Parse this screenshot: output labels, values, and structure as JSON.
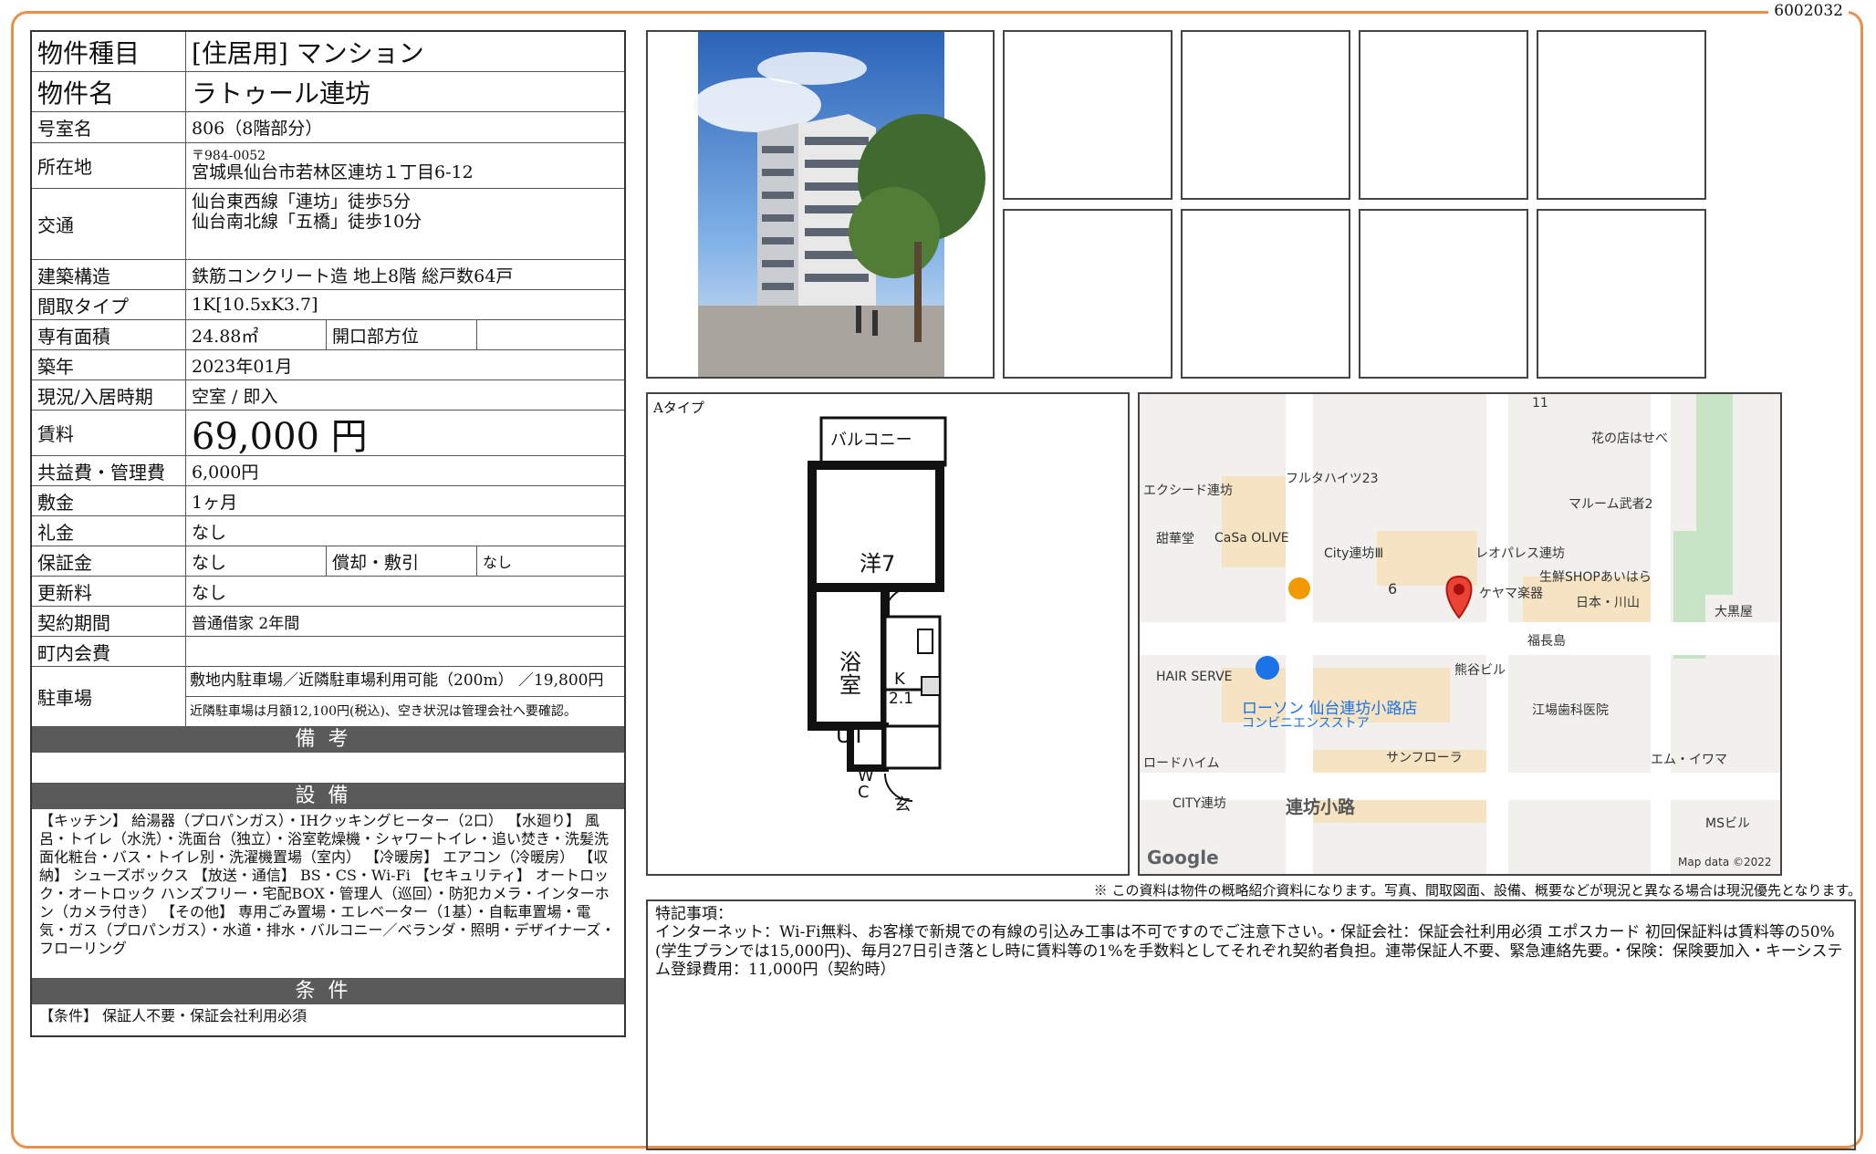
{
  "doc_id": "6002032",
  "property": {
    "type_label": "物件種目",
    "type_value": "[住居用] マンション",
    "name_label": "物件名",
    "name_value": "ラトゥール連坊",
    "room_label": "号室名",
    "room_value": "806（8階部分）",
    "address_label": "所在地",
    "postal": "〒984-0052",
    "address": "宮城県仙台市若林区連坊１丁目6-12",
    "transit_label": "交通",
    "transit_1": "仙台東西線「連坊」徒歩5分",
    "transit_2": "仙台南北線「五橋」徒歩10分",
    "structure_label": "建築構造",
    "structure_value": "鉄筋コンクリート造 地上8階 総戸数64戸",
    "layout_label": "間取タイプ",
    "layout_value": "1K[10.5xK3.7]",
    "area_label": "専有面積",
    "area_value": "24.88㎡",
    "facing_label": "開口部方位",
    "facing_value": "",
    "built_label": "築年",
    "built_value": "2023年01月",
    "status_label": "現況/入居時期",
    "status_value": "空室 / 即入",
    "rent_label": "賃料",
    "rent_value": "69,000 円",
    "fee_label": "共益費・管理費",
    "fee_value": "6,000円",
    "deposit_label": "敷金",
    "deposit_value": "1ヶ月",
    "keymoney_label": "礼金",
    "keymoney_value": "なし",
    "guarantee_label": "保証金",
    "guarantee_value": "なし",
    "amort_label": "償却・敷引",
    "amort_value": "なし",
    "renewal_label": "更新料",
    "renewal_value": "なし",
    "contract_label": "契約期間",
    "contract_value": "普通借家 2年間",
    "community_label": "町内会費",
    "community_value": "",
    "parking_label": "駐車場",
    "parking_value": "敷地内駐車場／近隣駐車場利用可能（200m） ／19,800円",
    "parking_note": "近隣駐車場は月額12,100円(税込)、空き状況は管理会社へ要確認。"
  },
  "remarks_header": "備考",
  "remarks_text": "",
  "equipment_header": "設備",
  "equipment_text": "【キッチン】 給湯器（プロパンガス）・IHクッキングヒーター（2口） 【水廻り】 風呂・トイレ（水洗）・洗面台（独立）・浴室乾燥機・シャワートイレ・追い焚き・洗髪洗面化粧台・バス・トイレ別・洗濯機置場（室内） 【冷暖房】 エアコン（冷暖房） 【収納】 シューズボックス 【放送・通信】 BS・CS・Wi-Fi 【セキュリティ】 オートロック・オートロック ハンズフリー・宅配BOX・管理人（巡回）・防犯カメラ・インターホン（カメラ付き） 【その他】 専用ごみ置場・エレベーター（1基）・自転車置場・電気・ガス（プロパンガス）・水道・排水・バルコニー／ベランダ・照明・デザイナーズ・フローリング",
  "conditions_header": "条件",
  "conditions_text": "【条件】 保証人不要・保証会社利用必須",
  "floorplan": {
    "type_label": "Aタイプ",
    "balcony": "バルコニー",
    "western": "洋7",
    "bath": "浴室",
    "kitchen": "K",
    "kitchen_size": "2.1",
    "ut": "UT",
    "wc": "WC",
    "entrance": "玄"
  },
  "map": {
    "labels": [
      "11",
      "花の店はせべ",
      "フルタハイツ23",
      "エクシード連坊",
      "マルーム武者2",
      "甜華堂",
      "CaSa OLIVE",
      "City連坊Ⅲ",
      "レオパレス連坊",
      "生鮮SHOPあいはら",
      "6",
      "ケヤマ楽器",
      "日本・川山",
      "大黒屋",
      "福長島",
      "HAIR SERVE",
      "熊谷ビル",
      "ローソン 仙台連坊小路店",
      "コンビニエンスストア",
      "江場歯科医院",
      "ロードハイム",
      "サンフローラ",
      "エム・イワマ",
      "CITY連坊",
      "連坊小路",
      "MSビル",
      "Google",
      "Map data ©2022"
    ],
    "accent_blue": "#1a73e8",
    "pin_red": "#ea4335"
  },
  "disclaimer": "※ この資料は物件の概略紹介資料になります。写真、間取図面、設備、概要などが現況と異なる場合は現況優先となります。",
  "notes": {
    "title": "特記事項：",
    "body": "インターネット：Wi-Fi無料、お客様で新規での有線の引込み工事は不可ですのでご注意下さい。・保証会社：保証会社利用必須 エポスカード 初回保証料は賃料等の50%(学生プランでは15,000円)、毎月27日引き落とし時に賃料等の1%を手数料としてそれぞれ契約者負担。連帯保証人不要、緊急連絡先要。・保険：保険要加入・キーシステム登録費用：11,000円（契約時）"
  }
}
